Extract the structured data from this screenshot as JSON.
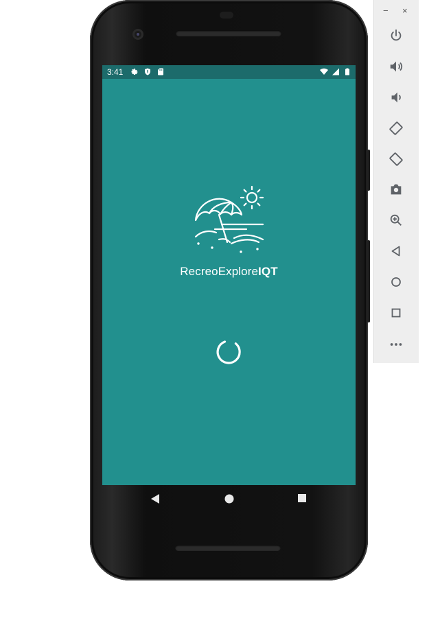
{
  "status_bar": {
    "time": "3:41",
    "left_icons": [
      "settings-icon",
      "shield-icon",
      "sd-card-icon"
    ],
    "right_icons": [
      "wifi-icon",
      "cell-signal-icon",
      "battery-icon"
    ]
  },
  "app": {
    "name_regular": "RecreoExplore",
    "name_bold": "IQT",
    "logo": "beach-umbrella-sun-icon",
    "loading_indicator": "spinner"
  },
  "nav_bar": {
    "buttons": [
      "back-icon",
      "home-icon",
      "recents-icon"
    ]
  },
  "emulator_panel": {
    "window_controls": {
      "minimize": "−",
      "close": "×"
    },
    "buttons": [
      "power",
      "volume-up",
      "volume-down",
      "rotate-left",
      "rotate-right",
      "screenshot",
      "zoom",
      "back",
      "home",
      "overview",
      "more"
    ]
  },
  "colors": {
    "screen_background": "#22908e",
    "status_bar": "#1c6b6b",
    "panel_background": "#eeeeee",
    "panel_icon": "#5f6368"
  }
}
